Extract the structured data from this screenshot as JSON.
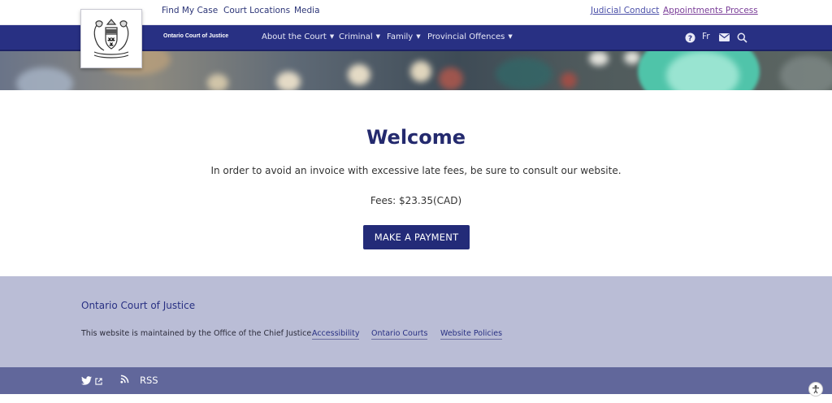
{
  "topbar": {
    "links_left": [
      "Find My Case",
      "Court Locations",
      "Media"
    ],
    "link_judicial": "Judicial Conduct",
    "link_appointments": "Appointments Process"
  },
  "nav": {
    "brand": "Ontario Court of Justice",
    "items": [
      "About the Court",
      "Criminal",
      "Family",
      "Provincial Offences"
    ],
    "lang": "Fr",
    "icons": [
      "help-icon",
      "mail-icon",
      "search-icon"
    ]
  },
  "main": {
    "title": "Welcome",
    "message": "In order to avoid an invoice with excessive late fees, be sure to consult our website.",
    "fees": "Fees: $23.35(CAD)",
    "button": "MAKE A PAYMENT"
  },
  "footer": {
    "title": "Ontario Court of Justice",
    "text": "This website is maintained by the Office of the Chief Justice.",
    "links": [
      "Accessibility",
      "Ontario Courts",
      "Website Policies"
    ],
    "rss": "RSS"
  },
  "colors": {
    "nav_bg": "#283083",
    "accent": "#242a6e",
    "footer_bg": "#babdd6",
    "bottombar_bg": "#61679b"
  }
}
